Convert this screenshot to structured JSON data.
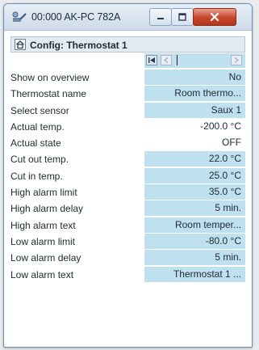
{
  "window": {
    "title": "00:000 AK-PC 782A",
    "icon": "probe-app-icon",
    "colors": {
      "close_button": "#c6462a",
      "editable_cell": "#bfe0ef"
    }
  },
  "config": {
    "title": "Config: Thermostat 1",
    "home_icon": "home-icon"
  },
  "navigator": {
    "first_icon": "first-page-icon",
    "prev_icon": "prev-page-icon",
    "next_icon": "next-page-icon"
  },
  "rows": [
    {
      "label": "Show on overview",
      "value": "No",
      "editable": true
    },
    {
      "label": "Thermostat name",
      "value": "Room thermo...",
      "editable": true
    },
    {
      "label": "Select sensor",
      "value": "Saux 1",
      "editable": true
    },
    {
      "label": "Actual temp.",
      "value": "-200.0 °C",
      "editable": false
    },
    {
      "label": "Actual state",
      "value": "OFF",
      "editable": false
    },
    {
      "label": "Cut out temp.",
      "value": "22.0 °C",
      "editable": true
    },
    {
      "label": "Cut in temp.",
      "value": "25.0 °C",
      "editable": true
    },
    {
      "label": "High alarm limit",
      "value": "35.0 °C",
      "editable": true
    },
    {
      "label": "High alarm delay",
      "value": "5 min.",
      "editable": true
    },
    {
      "label": "High alarm text",
      "value": "Room temper...",
      "editable": true
    },
    {
      "label": "Low alarm limit",
      "value": "-80.0 °C",
      "editable": true
    },
    {
      "label": "Low alarm delay",
      "value": "5 min.",
      "editable": true
    },
    {
      "label": "Low alarm text",
      "value": "Thermostat 1 ...",
      "editable": true
    }
  ]
}
